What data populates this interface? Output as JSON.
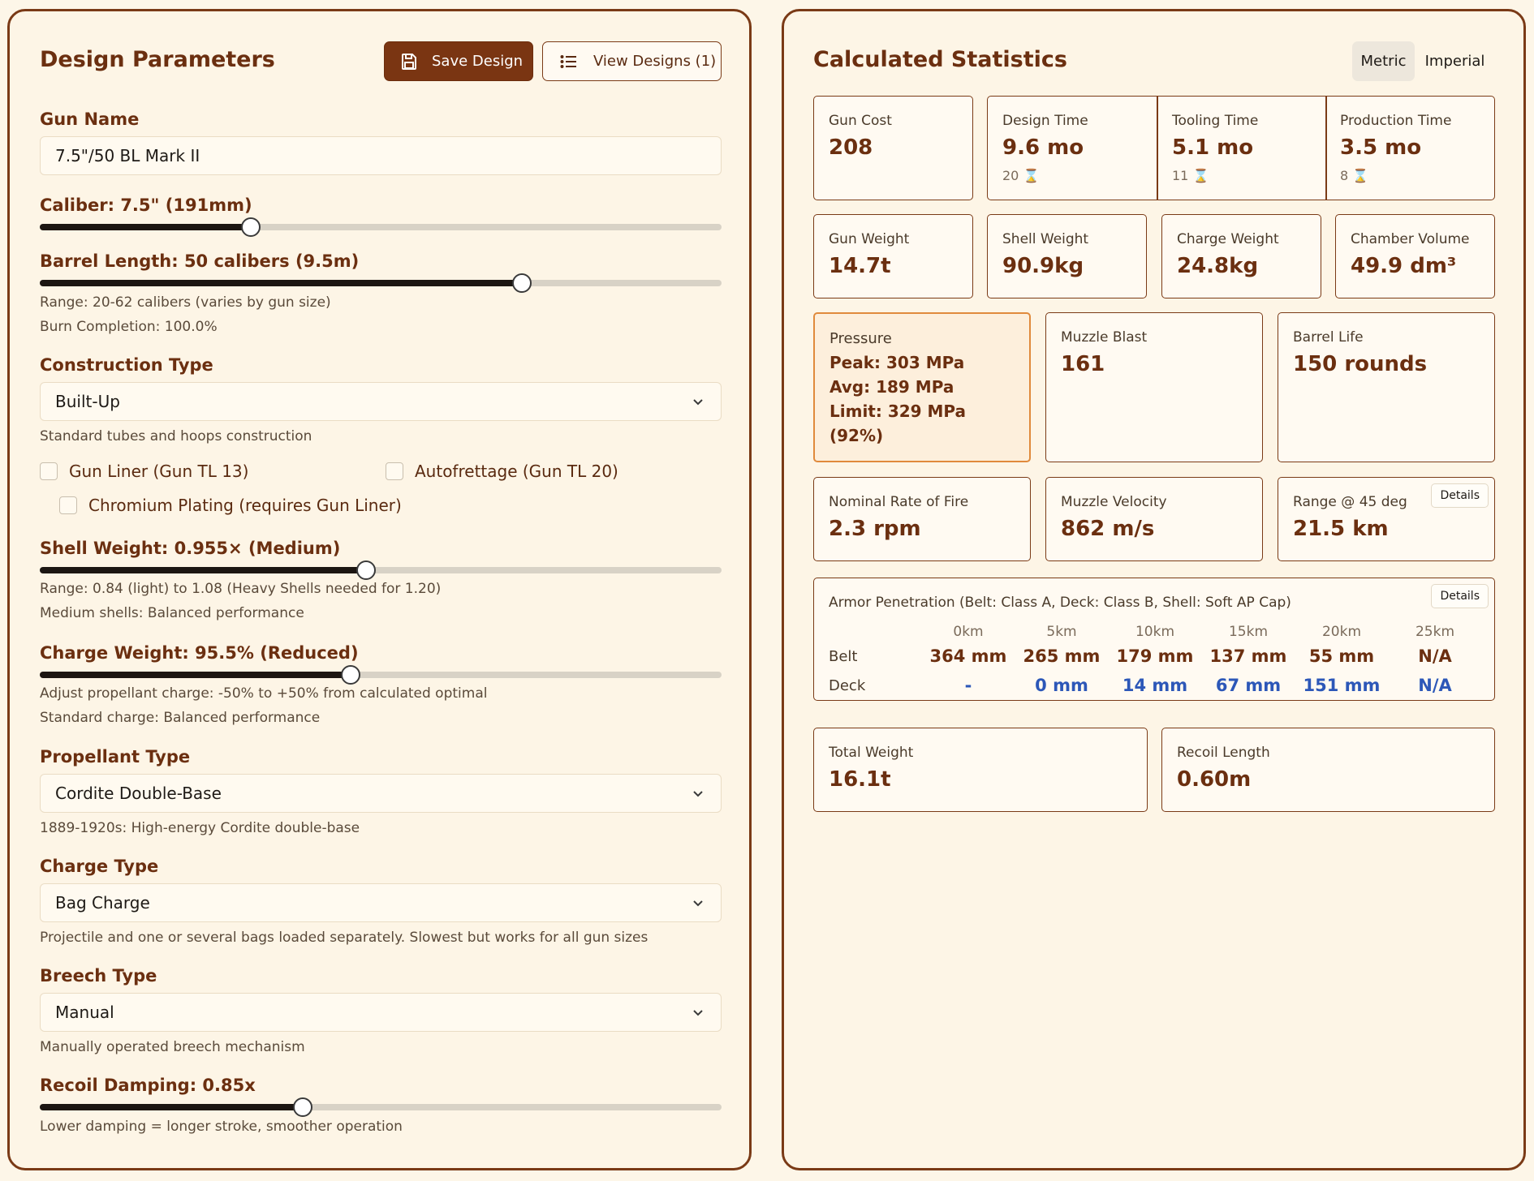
{
  "design": {
    "title": "Design Parameters",
    "save_label": "Save Design",
    "view_label": "View Designs (1)",
    "gun_name": {
      "label": "Gun Name",
      "value": "7.5\"/50 BL Mark II"
    },
    "caliber": {
      "label": "Caliber: 7.5\" (191mm)",
      "fraction": 0.309
    },
    "barrel_length": {
      "label": "Barrel Length: 50 calibers (9.5m)",
      "fraction": 0.707,
      "hint_range": "Range: 20-62 calibers (varies by gun size)",
      "hint_burn": "Burn Completion: 100.0%"
    },
    "construction": {
      "label": "Construction Type",
      "value": "Built-Up",
      "hint": "Standard tubes and hoops construction",
      "gun_liner": "Gun Liner (Gun TL 13)",
      "autofrettage": "Autofrettage (Gun TL 20)",
      "chromium": "Chromium Plating (requires Gun Liner)"
    },
    "shell_weight": {
      "label": "Shell Weight: 0.955× (Medium)",
      "fraction": 0.479,
      "hint_range": "Range: 0.84 (light) to 1.08 (Heavy Shells needed for 1.20)",
      "hint_desc": "Medium shells: Balanced performance"
    },
    "charge_weight": {
      "label": "Charge Weight: 95.5% (Reduced)",
      "fraction": 0.456,
      "hint_range": "Adjust propellant charge: -50% to +50% from calculated optimal",
      "hint_desc": "Standard charge: Balanced performance"
    },
    "propellant": {
      "label": "Propellant Type",
      "value": "Cordite Double-Base",
      "hint": "1889-1920s: High-energy Cordite double-base"
    },
    "charge_type": {
      "label": "Charge Type",
      "value": "Bag Charge",
      "hint": "Projectile and one or several bags loaded separately. Slowest but works for all gun sizes"
    },
    "breech": {
      "label": "Breech Type",
      "value": "Manual",
      "hint": "Manually operated breech mechanism"
    },
    "recoil": {
      "label": "Recoil Damping: 0.85x",
      "fraction": 0.386,
      "hint": "Lower damping = longer stroke, smoother operation"
    }
  },
  "stats": {
    "title": "Calculated Statistics",
    "unit_metric": "Metric",
    "unit_imperial": "Imperial",
    "gun_cost": {
      "label": "Gun Cost",
      "value": "208"
    },
    "design_time": {
      "label": "Design Time",
      "value": "9.6 mo",
      "sub": "20 ⌛"
    },
    "tooling_time": {
      "label": "Tooling Time",
      "value": "5.1 mo",
      "sub": "11 ⌛"
    },
    "production_time": {
      "label": "Production Time",
      "value": "3.5 mo",
      "sub": "8 ⌛"
    },
    "gun_weight": {
      "label": "Gun Weight",
      "value": "14.7t"
    },
    "shell_weight": {
      "label": "Shell Weight",
      "value": "90.9kg"
    },
    "charge_weight": {
      "label": "Charge Weight",
      "value": "24.8kg"
    },
    "chamber_volume": {
      "label": "Chamber Volume",
      "value": "49.9 dm³"
    },
    "pressure": {
      "label": "Pressure",
      "peak": "Peak: 303 MPa",
      "avg": "Avg: 189 MPa",
      "limit": "Limit: 329 MPa",
      "pct": "(92%)"
    },
    "muzzle_blast": {
      "label": "Muzzle Blast",
      "value": "161"
    },
    "barrel_life": {
      "label": "Barrel Life",
      "value": "150 rounds"
    },
    "rate_of_fire": {
      "label": "Nominal Rate of Fire",
      "value": "2.3 rpm"
    },
    "muzzle_velocity": {
      "label": "Muzzle Velocity",
      "value": "862 m/s"
    },
    "range": {
      "label": "Range @ 45 deg",
      "value": "21.5 km",
      "details": "Details"
    },
    "armor": {
      "title": "Armor Penetration (Belt: Class A, Deck: Class B, Shell: Soft AP Cap)",
      "details": "Details",
      "headers": [
        "0km",
        "5km",
        "10km",
        "15km",
        "20km",
        "25km"
      ],
      "belt_label": "Belt",
      "deck_label": "Deck",
      "belt": [
        "364 mm",
        "265 mm",
        "179 mm",
        "137 mm",
        "55 mm",
        "N/A"
      ],
      "deck": [
        "-",
        "0 mm",
        "14 mm",
        "67 mm",
        "151 mm",
        "N/A"
      ]
    },
    "total_weight": {
      "label": "Total Weight",
      "value": "16.1t"
    },
    "recoil_length": {
      "label": "Recoil Length",
      "value": "0.60m"
    }
  }
}
